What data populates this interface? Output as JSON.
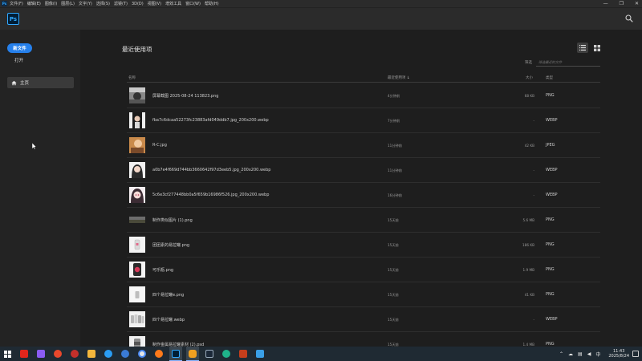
{
  "menubar": {
    "logo": "Ps",
    "items": [
      "文件(F)",
      "编辑(E)",
      "图像(I)",
      "图层(L)",
      "文字(Y)",
      "选择(S)",
      "滤镜(T)",
      "3D(D)",
      "视图(V)",
      "增效工具",
      "窗口(W)",
      "帮助(H)"
    ],
    "controls": [
      "—",
      "❐",
      "✕"
    ]
  },
  "appbar": {
    "logo": "Ps"
  },
  "sidebar": {
    "new_label": "新文件",
    "open_label": "打开",
    "home_label": "主页"
  },
  "main": {
    "title": "最近使用项",
    "filter_label": "筛选",
    "filter_placeholder": "筛选最近的文件",
    "columns": {
      "name": "名称",
      "time": "最近使用项",
      "size": "大小",
      "type": "类型"
    },
    "sort_arrow": "↓",
    "files": [
      {
        "name": "屏幕截图 2025-08-24 113823.png",
        "time": "4分钟前",
        "size": "68 KB",
        "type": "PNG",
        "thumb": "photo-gray"
      },
      {
        "name": "fba7c6dcaa52273fc23883afd049ddb7.jpg_200x200.webp",
        "time": "7分钟前",
        "size": "-",
        "type": "WEBP",
        "thumb": "portrait-dark"
      },
      {
        "name": "R-C.jpg",
        "time": "11分钟前",
        "size": "42 KB",
        "type": "JPEG",
        "thumb": "portrait-warm"
      },
      {
        "name": "a0b7e4f669d744bb3660642f97d3eeb5.jpg_200x200.webp",
        "time": "11分钟前",
        "size": "-",
        "type": "WEBP",
        "thumb": "portrait-light"
      },
      {
        "name": "5c6e3cf277448bb0a5f659b16986f526.jpg_200x200.webp",
        "time": "16分钟前",
        "size": "-",
        "type": "WEBP",
        "thumb": "portrait-anime"
      },
      {
        "name": "制作类似图片 (1).png",
        "time": "15天前",
        "size": "5.6 MB",
        "type": "PNG",
        "thumb": "landscape"
      },
      {
        "name": "团团素的易拉罐.png",
        "time": "15天前",
        "size": "186 KB",
        "type": "PNG",
        "thumb": "can-white"
      },
      {
        "name": "可乐瓶.png",
        "time": "15天前",
        "size": "1.9 MB",
        "type": "PNG",
        "thumb": "can-red"
      },
      {
        "name": "四个易拉罐e.png",
        "time": "15天前",
        "size": "41 KB",
        "type": "PNG",
        "thumb": "can-silver"
      },
      {
        "name": "四个易拉罐.webp",
        "time": "15天前",
        "size": "-",
        "type": "WEBP",
        "thumb": "cans-group"
      },
      {
        "name": "制作金属易拉罐素材 (2).psd",
        "time": "15天前",
        "size": "1.4 MB",
        "type": "PNG",
        "thumb": "can-metal"
      }
    ]
  },
  "taskbar": {
    "apps": [
      "acrobat",
      "obsidian",
      "wps",
      "netease",
      "files",
      "edge",
      "chrome-k",
      "chrome",
      "firefox",
      "photoshop",
      "gif",
      "steam",
      "edge2",
      "ppt",
      "paint"
    ],
    "tray_ime": "中",
    "time": "11:43",
    "date": "2025/8/24"
  }
}
